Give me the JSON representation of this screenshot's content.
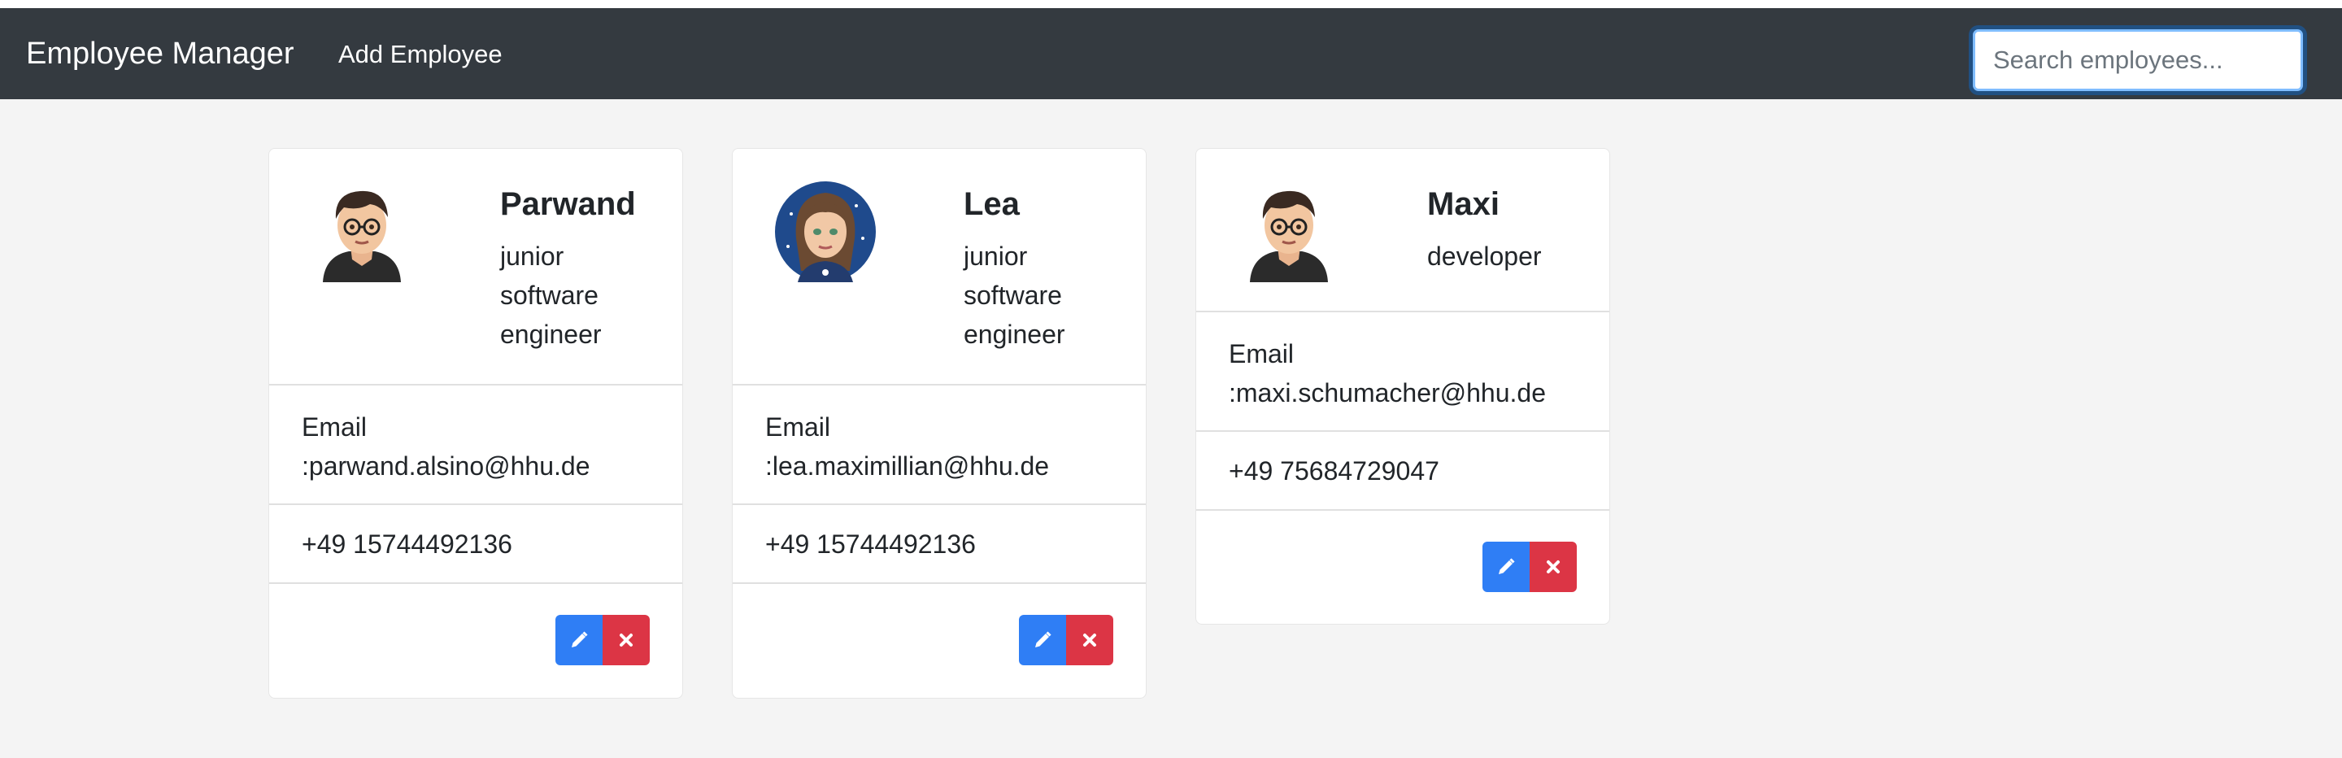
{
  "navbar": {
    "brand": "Employee Manager",
    "add_link": "Add Employee",
    "search": {
      "placeholder": "Search employees...",
      "value": ""
    }
  },
  "colors": {
    "navbar_bg": "#343a40",
    "page_bg": "#f4f4f4",
    "edit_button": "#2f7ef5",
    "delete_button": "#dc3545"
  },
  "employees": [
    {
      "name": "Parwand",
      "title": "junior software engineer",
      "email_label": "Email",
      "email": ":parwand.alsino@hhu.de",
      "phone": "+49 15744492136",
      "avatar_icon": "male-avatar-glasses-icon",
      "edit_icon": "pencil-icon",
      "delete_icon": "close-icon"
    },
    {
      "name": "Lea",
      "title": "junior software engineer",
      "email_label": "Email",
      "email": ":lea.maximillian@hhu.de",
      "phone": "+49 15744492136",
      "avatar_icon": "female-avatar-icon",
      "edit_icon": "pencil-icon",
      "delete_icon": "close-icon"
    },
    {
      "name": "Maxi",
      "title": "developer",
      "email_label": "Email",
      "email": ":maxi.schumacher@hhu.de",
      "phone": "+49 75684729047",
      "avatar_icon": "male-avatar-glasses-icon",
      "edit_icon": "pencil-icon",
      "delete_icon": "close-icon"
    }
  ]
}
